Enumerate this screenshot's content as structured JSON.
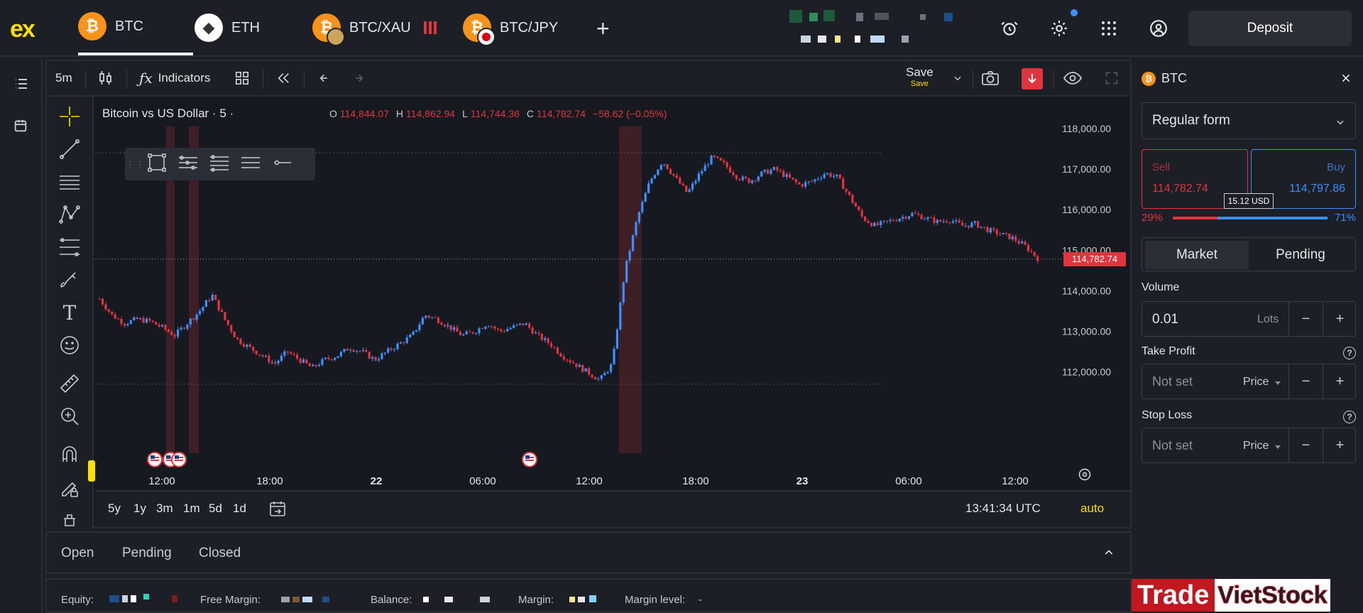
{
  "topbar": {
    "logo": "ex",
    "tabs": [
      {
        "label": "BTC",
        "active": true,
        "coin": "₿"
      },
      {
        "label": "ETH",
        "coin": "◆"
      },
      {
        "label": "BTC/XAU",
        "coin": "₿"
      },
      {
        "label": "BTC/JPY",
        "coin": "₿"
      }
    ],
    "add_tab": "+",
    "deposit_label": "Deposit"
  },
  "toolbar": {
    "interval": "5m",
    "indicators_label": "Indicators",
    "save_label": "Save",
    "save_sub": "Save"
  },
  "chart": {
    "title": "Bitcoin vs US Dollar · 5 ·",
    "ohlc": {
      "o_label": "O",
      "o": "114,844.07",
      "h_label": "H",
      "h": "114,862.94",
      "l_label": "L",
      "l": "114,744.36",
      "c_label": "C",
      "c": "114,782.74",
      "change": "−58.62 (−0.05%)"
    },
    "current_price_label": "114,782.74",
    "y_ticks": [
      "118,000.00",
      "117,000.00",
      "116,000.00",
      "115,000.00",
      "114,000.00",
      "113,000.00",
      "112,000.00"
    ],
    "x_ticks": [
      "12:00",
      "18:00",
      "22",
      "06:00",
      "12:00",
      "18:00",
      "23",
      "06:00",
      "12:00"
    ],
    "time_utc": "13:41:34 UTC",
    "auto_label": "auto",
    "ranges": [
      "5y",
      "1y",
      "3m",
      "1m",
      "5d",
      "1d"
    ]
  },
  "chart_data": {
    "type": "line",
    "title": "Bitcoin vs US Dollar · 5 ·",
    "xlabel": "",
    "ylabel": "",
    "ylim": [
      111400,
      118400
    ],
    "x_tick_labels": [
      "12:00",
      "18:00",
      "22",
      "06:00",
      "12:00",
      "18:00",
      "23",
      "06:00",
      "12:00"
    ],
    "series": [
      {
        "values": [
          113800,
          113400,
          113200,
          113300,
          113250,
          113100,
          112900,
          113200,
          113500,
          113900,
          113300,
          112800,
          112600,
          112400,
          112200,
          112500,
          112300,
          112100,
          112300,
          112400,
          112600,
          112500,
          112300,
          112500,
          112700,
          112900,
          113400,
          113300,
          113100,
          112900,
          113000,
          113200,
          113000,
          113100,
          113200,
          112900,
          112700,
          112400,
          112200,
          112000,
          111800,
          112200,
          114500,
          115800,
          116700,
          117200,
          116800,
          116400,
          116900,
          117300,
          117100,
          116800,
          116700,
          116900,
          117000,
          116800,
          116600,
          116700,
          116900,
          116800,
          116300,
          115800,
          115600,
          115700,
          115800,
          115900,
          115800,
          115700,
          115750,
          115600,
          115650,
          115500,
          115400,
          115300,
          115100,
          114800
        ]
      }
    ],
    "current_price": 114782.74,
    "event_markers": [
      "us-flag",
      "us-flag",
      "us-flag",
      "us-flag"
    ]
  },
  "orders": {
    "tabs": [
      "Open",
      "Pending",
      "Closed"
    ]
  },
  "status": {
    "equity_label": "Equity:",
    "free_margin_label": "Free Margin:",
    "balance_label": "Balance:",
    "margin_label": "Margin:",
    "margin_level_label": "Margin level:",
    "margin_level_value": "-"
  },
  "trade": {
    "symbol": "BTC",
    "form": "Regular form",
    "sell_label": "Sell",
    "sell_price": "114,782.74",
    "buy_label": "Buy",
    "buy_price": "114,797.86",
    "spread": "15.12 USD",
    "sell_pct": "29%",
    "buy_pct": "71%",
    "sell_fraction": 0.29,
    "market_label": "Market",
    "pending_label": "Pending",
    "volume_label": "Volume",
    "volume_value": "0.01",
    "volume_unit": "Lots",
    "tp_label": "Take Profit",
    "tp_value": "Not set",
    "tp_unit": "Price",
    "sl_label": "Stop Loss",
    "sl_value": "Not set",
    "sl_unit": "Price",
    "minus": "−",
    "plus": "+"
  },
  "watermark": {
    "part1": "Trade",
    "part2": "VietStock"
  },
  "colors": {
    "up": "#3d8fff",
    "down": "#e0353e",
    "accent": "#ffde02",
    "bg": "#161a20"
  }
}
